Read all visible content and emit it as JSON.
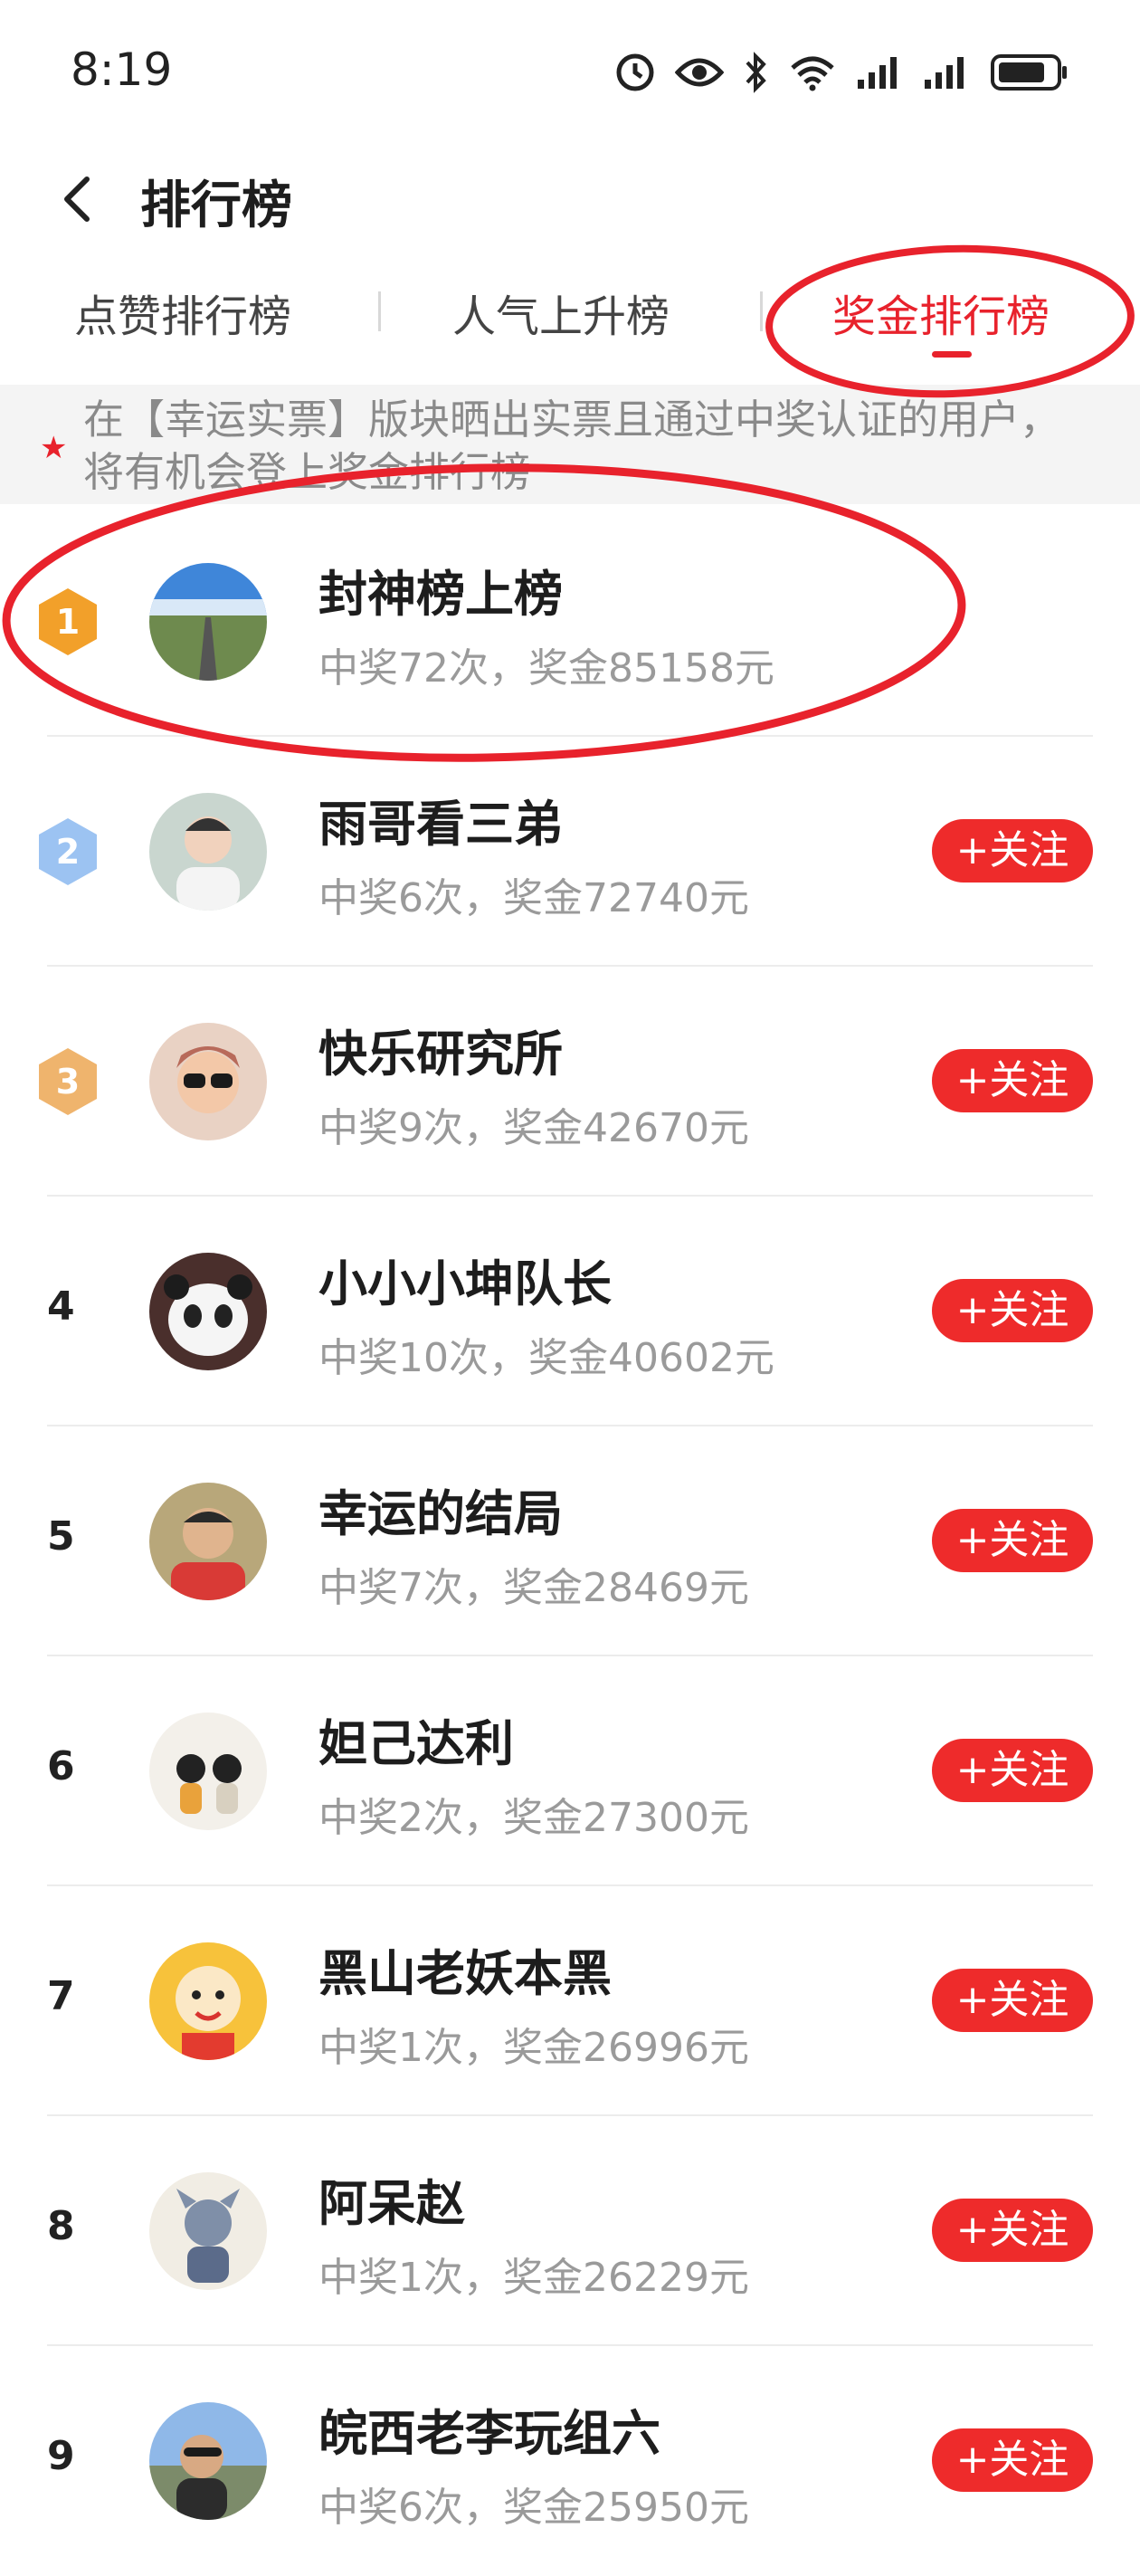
{
  "status_bar": {
    "time": "8:19",
    "icons": [
      "alarm-icon",
      "eye-icon",
      "bluetooth-icon",
      "wifi-icon",
      "signal-icon",
      "signal-icon",
      "battery-icon"
    ]
  },
  "header": {
    "title": "排行榜",
    "back_icon": "chevron-left-icon"
  },
  "tabs": [
    {
      "label": "点赞排行榜",
      "active": false
    },
    {
      "label": "人气上升榜",
      "active": false
    },
    {
      "label": "奖金排行榜",
      "active": true
    }
  ],
  "notice": {
    "text": "在【幸运实票】版块晒出实票且通过中奖认证的用户，将有机会登上奖金排行榜",
    "icon": "star-icon"
  },
  "ranking": [
    {
      "rank": "1",
      "name": "封神榜上榜",
      "stats": "中奖72次，奖金85158元",
      "follow": ""
    },
    {
      "rank": "2",
      "name": "雨哥看三弟",
      "stats": "中奖6次，奖金72740元",
      "follow": "+关注"
    },
    {
      "rank": "3",
      "name": "快乐研究所",
      "stats": "中奖9次，奖金42670元",
      "follow": "+关注"
    },
    {
      "rank": "4",
      "name": "小小小坤队长",
      "stats": "中奖10次，奖金40602元",
      "follow": "+关注"
    },
    {
      "rank": "5",
      "name": "幸运的结局",
      "stats": "中奖7次，奖金28469元",
      "follow": "+关注"
    },
    {
      "rank": "6",
      "name": "妲己达利",
      "stats": "中奖2次，奖金27300元",
      "follow": "+关注"
    },
    {
      "rank": "7",
      "name": "黑山老妖本黑",
      "stats": "中奖1次，奖金26996元",
      "follow": "+关注"
    },
    {
      "rank": "8",
      "name": "阿呆赵",
      "stats": "中奖1次，奖金26229元",
      "follow": "+关注"
    },
    {
      "rank": "9",
      "name": "皖西老李玩组六",
      "stats": "中奖6次，奖金25950元",
      "follow": "+关注"
    }
  ],
  "colors": {
    "accent": "#e8222c",
    "gold": "#f2a02a",
    "silver": "#9cc3f2",
    "bronze": "#efb46d"
  }
}
